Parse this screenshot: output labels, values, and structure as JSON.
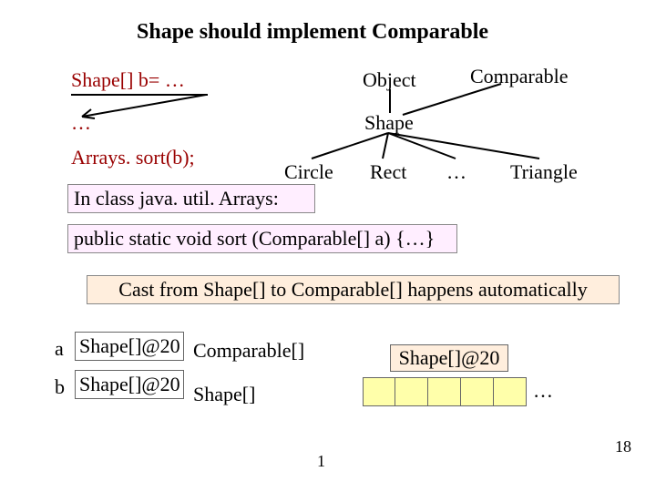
{
  "title": "Shape should implement Comparable",
  "code": {
    "l1": "Shape[] b= …",
    "l2": "…",
    "l3": "Arrays. sort(b);"
  },
  "tree": {
    "object": "Object",
    "comparable": "Comparable",
    "shape": "Shape",
    "circle": "Circle",
    "rect": "Rect",
    "ellipsis": "…",
    "triangle": "Triangle"
  },
  "caption1": "In class java. util. Arrays:",
  "caption2": "public static void sort (Comparable[] a) {…}",
  "caption3": "Cast from Shape[] to Comparable[] happens automatically",
  "vars": {
    "aLabel": "a",
    "aValue": "Shape[]@20",
    "bLabel": "b",
    "bValue": "Shape[]@20"
  },
  "types": {
    "comparableArr": "Comparable[]",
    "shapeArr": "Shape[]"
  },
  "obj": {
    "header": "Shape[]@20",
    "cellCount": 5,
    "ellipsis": "…"
  },
  "pageNumber": "18",
  "bottomNumber": "1"
}
